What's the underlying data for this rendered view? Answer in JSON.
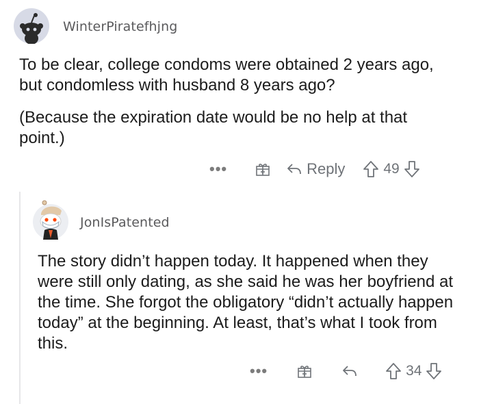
{
  "comment1": {
    "username": "WinterPiratefhjng",
    "paragraphs": [
      "To be clear, college condoms were obtained 2 years ago, but condomless with husband 8 years ago?",
      "(Because the expiration date would be no help at that point.)"
    ],
    "actions": {
      "more": "•••",
      "reply_label": "Reply",
      "votes": "49"
    }
  },
  "comment2": {
    "username": "JonIsPatented",
    "paragraphs": [
      "The story didn’t happen today. It happened when they were still only dating, as she said he was her boyfriend at the time. She forgot the obligatory “didn’t actually happen today” at the beginning. At least, that’s what I took from this."
    ],
    "actions": {
      "more": "•••",
      "votes": "34"
    }
  },
  "colors": {
    "text": "#1c1c1c",
    "muted": "#6f7378",
    "avatar_bg": "#d9dce7",
    "thread_line": "#e6e6e8"
  }
}
